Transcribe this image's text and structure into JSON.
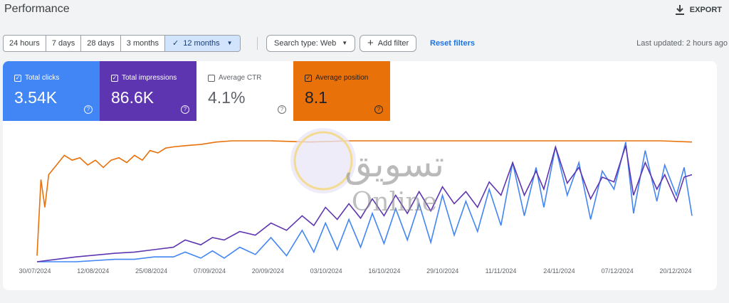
{
  "header": {
    "title": "Performance",
    "export_label": "EXPORT"
  },
  "toolbar": {
    "ranges": [
      "24 hours",
      "7 days",
      "28 days",
      "3 months",
      "12 months"
    ],
    "selected_range": "12 months",
    "search_type_label": "Search type: Web",
    "add_filter_label": "Add filter",
    "reset_label": "Reset filters",
    "last_updated": "Last updated: 2 hours ago"
  },
  "metrics": {
    "clicks": {
      "label": "Total clicks",
      "value": "3.54K",
      "checked": true,
      "color": "#4285f4"
    },
    "impressions": {
      "label": "Total impressions",
      "value": "86.6K",
      "checked": true,
      "color": "#5e35b1"
    },
    "ctr": {
      "label": "Average CTR",
      "value": "4.1%",
      "checked": false,
      "color": "#ffffff"
    },
    "position": {
      "label": "Average position",
      "value": "8.1",
      "checked": true,
      "color": "#e8710a"
    }
  },
  "watermark": {
    "text_ar": "تسويق",
    "text_en": "Online"
  },
  "chart_data": {
    "type": "line",
    "x_tick_labels": [
      "30/07/2024",
      "12/08/2024",
      "25/08/2024",
      "07/09/2024",
      "20/09/2024",
      "03/10/2024",
      "16/10/2024",
      "29/10/2024",
      "11/11/2024",
      "24/11/2024",
      "07/12/2024",
      "20/12/2024"
    ],
    "x_range": [
      "30/07/2024",
      "27/12/2024"
    ],
    "grid": false,
    "series": [
      {
        "name": "Total clicks",
        "color": "#4285f4",
        "points": [
          [
            0,
            0.0
          ],
          [
            10,
            0.0
          ],
          [
            20,
            0.02
          ],
          [
            25,
            0.02
          ],
          [
            30,
            0.04
          ],
          [
            35,
            0.04
          ],
          [
            38,
            0.08
          ],
          [
            42,
            0.03
          ],
          [
            45,
            0.09
          ],
          [
            48,
            0.03
          ],
          [
            52,
            0.12
          ],
          [
            56,
            0.06
          ],
          [
            60,
            0.2
          ],
          [
            64,
            0.05
          ],
          [
            68,
            0.26
          ],
          [
            71,
            0.08
          ],
          [
            74,
            0.32
          ],
          [
            77,
            0.1
          ],
          [
            80,
            0.35
          ],
          [
            83,
            0.12
          ],
          [
            86,
            0.4
          ],
          [
            89,
            0.15
          ],
          [
            92,
            0.44
          ],
          [
            95,
            0.18
          ],
          [
            98,
            0.48
          ],
          [
            101,
            0.16
          ],
          [
            104,
            0.55
          ],
          [
            107,
            0.22
          ],
          [
            110,
            0.5
          ],
          [
            113,
            0.25
          ],
          [
            116,
            0.6
          ],
          [
            119,
            0.3
          ],
          [
            122,
            0.82
          ],
          [
            125,
            0.38
          ],
          [
            128,
            0.78
          ],
          [
            130,
            0.45
          ],
          [
            133,
            0.95
          ],
          [
            136,
            0.55
          ],
          [
            139,
            0.82
          ],
          [
            142,
            0.35
          ],
          [
            145,
            0.75
          ],
          [
            148,
            0.6
          ],
          [
            151,
            0.99
          ],
          [
            153,
            0.4
          ],
          [
            156,
            0.92
          ],
          [
            159,
            0.5
          ],
          [
            161,
            0.8
          ],
          [
            164,
            0.55
          ],
          [
            166,
            0.78
          ],
          [
            168,
            0.38
          ]
        ]
      },
      {
        "name": "Total impressions",
        "color": "#5e35b1",
        "points": [
          [
            0,
            0.0
          ],
          [
            5,
            0.02
          ],
          [
            10,
            0.04
          ],
          [
            20,
            0.07
          ],
          [
            25,
            0.08
          ],
          [
            30,
            0.1
          ],
          [
            35,
            0.12
          ],
          [
            38,
            0.18
          ],
          [
            42,
            0.14
          ],
          [
            45,
            0.2
          ],
          [
            48,
            0.18
          ],
          [
            52,
            0.25
          ],
          [
            56,
            0.22
          ],
          [
            60,
            0.32
          ],
          [
            64,
            0.26
          ],
          [
            68,
            0.38
          ],
          [
            71,
            0.3
          ],
          [
            74,
            0.45
          ],
          [
            77,
            0.35
          ],
          [
            80,
            0.48
          ],
          [
            83,
            0.36
          ],
          [
            86,
            0.52
          ],
          [
            89,
            0.38
          ],
          [
            92,
            0.55
          ],
          [
            95,
            0.4
          ],
          [
            98,
            0.58
          ],
          [
            101,
            0.42
          ],
          [
            104,
            0.62
          ],
          [
            107,
            0.48
          ],
          [
            110,
            0.58
          ],
          [
            113,
            0.45
          ],
          [
            116,
            0.66
          ],
          [
            119,
            0.55
          ],
          [
            122,
            0.82
          ],
          [
            125,
            0.55
          ],
          [
            128,
            0.75
          ],
          [
            130,
            0.6
          ],
          [
            133,
            0.95
          ],
          [
            136,
            0.65
          ],
          [
            139,
            0.78
          ],
          [
            142,
            0.52
          ],
          [
            145,
            0.7
          ],
          [
            148,
            0.66
          ],
          [
            151,
            0.96
          ],
          [
            153,
            0.55
          ],
          [
            156,
            0.82
          ],
          [
            159,
            0.6
          ],
          [
            161,
            0.72
          ],
          [
            164,
            0.5
          ],
          [
            166,
            0.7
          ],
          [
            168,
            0.72
          ]
        ]
      },
      {
        "name": "Average position",
        "color": "#e8710a",
        "points": [
          [
            0,
            0.05
          ],
          [
            1,
            0.68
          ],
          [
            2,
            0.45
          ],
          [
            3,
            0.72
          ],
          [
            5,
            0.8
          ],
          [
            7,
            0.88
          ],
          [
            9,
            0.84
          ],
          [
            11,
            0.86
          ],
          [
            13,
            0.8
          ],
          [
            15,
            0.84
          ],
          [
            17,
            0.78
          ],
          [
            19,
            0.84
          ],
          [
            21,
            0.86
          ],
          [
            23,
            0.82
          ],
          [
            25,
            0.88
          ],
          [
            27,
            0.84
          ],
          [
            29,
            0.92
          ],
          [
            31,
            0.9
          ],
          [
            33,
            0.94
          ],
          [
            35,
            0.95
          ],
          [
            38,
            0.96
          ],
          [
            42,
            0.97
          ],
          [
            46,
            0.99
          ],
          [
            50,
            1.0
          ],
          [
            60,
            1.0
          ],
          [
            70,
            0.99
          ],
          [
            80,
            1.0
          ],
          [
            90,
            1.0
          ],
          [
            100,
            1.0
          ],
          [
            110,
            1.0
          ],
          [
            120,
            1.0
          ],
          [
            130,
            1.0
          ],
          [
            140,
            1.0
          ],
          [
            150,
            1.0
          ],
          [
            160,
            1.0
          ],
          [
            168,
            0.99
          ]
        ]
      }
    ]
  }
}
